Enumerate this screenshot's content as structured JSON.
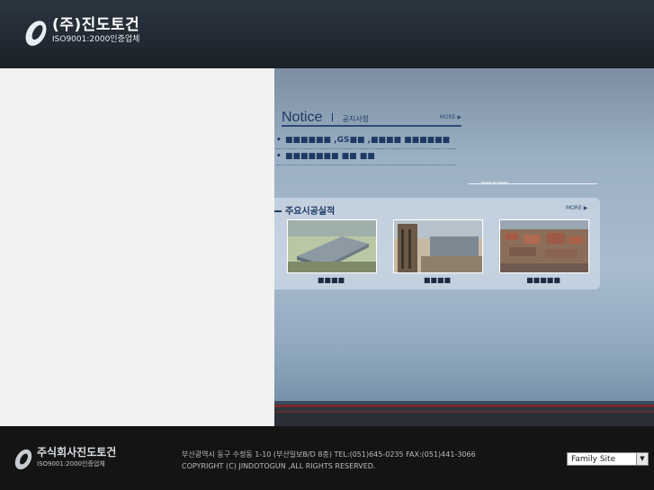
{
  "header": {
    "company": "(주)진도토건",
    "cert": "ISO9001:2000인증업체"
  },
  "notice": {
    "title": "Notice",
    "subtitle": "공지사항",
    "more": "MORE ▶",
    "items": [
      "■■■■■■ ,GS■■ ,■■■■ ■■■■■■",
      "■■■■■■■ ■■ ■■"
    ]
  },
  "side_link": {
    "label": "━━━ ━ ━━━"
  },
  "projects": {
    "title": "주요시공실적",
    "more": "MORE ▶",
    "items": [
      {
        "label": "■■■■"
      },
      {
        "label": "■■■■"
      },
      {
        "label": "■■■■■"
      }
    ]
  },
  "footer": {
    "company": "주식회사진도토건",
    "cert": "ISO9001:2000인증업체",
    "address": "부산광역시 동구 수정동 1-10 (부산일보B/D 8층)  TEL:(051)645-0235  FAX:(051)441-3066",
    "copyright": "COPYRIGHT (C) JINDOTOGUN ,ALL RIGHTS RESERVED.",
    "family_site": "Family Site"
  },
  "colors": {
    "header_bg": "#222a33",
    "accent_navy": "#1c3a63",
    "footer_bg": "#141414"
  }
}
